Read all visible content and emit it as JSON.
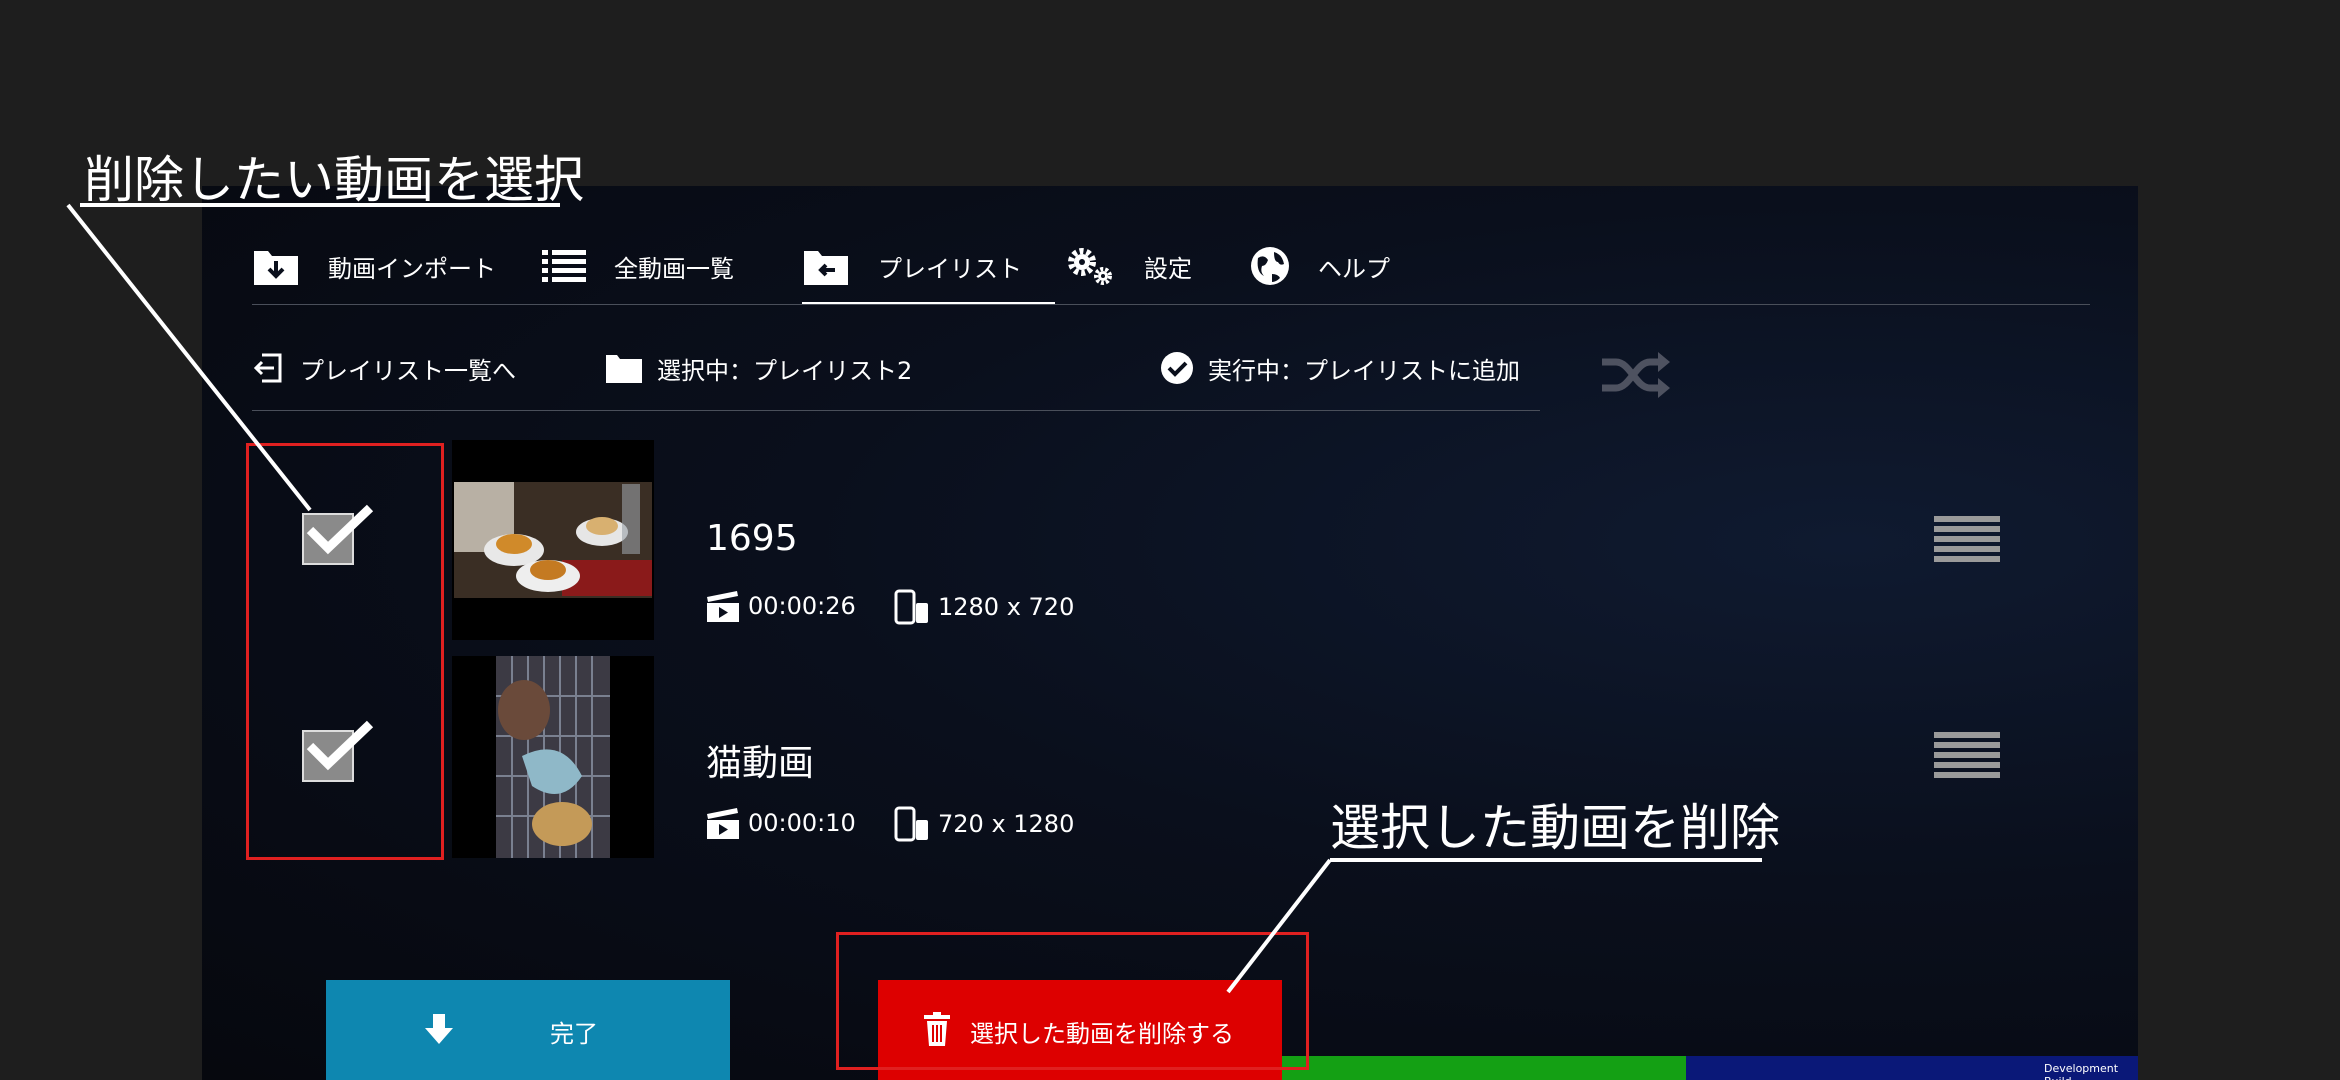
{
  "tabs": [
    {
      "label": "動画インポート",
      "icon": "import-folder-icon"
    },
    {
      "label": "全動画一覧",
      "icon": "list-icon"
    },
    {
      "label": "プレイリスト",
      "icon": "playlist-folder-icon",
      "active": true
    },
    {
      "label": "設定",
      "icon": "gears-icon"
    },
    {
      "label": "ヘルプ",
      "icon": "globe-icon"
    }
  ],
  "subbar": {
    "back_label": "プレイリスト一覧へ",
    "selected_label": "選択中：プレイリスト2",
    "running_label": "実行中：プレイリストに追加"
  },
  "videos": [
    {
      "title": "1695",
      "duration": "00:00:26",
      "resolution": "1280 x 720",
      "checked": true
    },
    {
      "title": "猫動画",
      "duration": "00:00:10",
      "resolution": "720 x 1280",
      "checked": true
    }
  ],
  "buttons": {
    "done_label": "完了",
    "delete_label": "選択した動画を削除する"
  },
  "annotations": {
    "select_label": "削除したい動画を選択",
    "delete_label": "選択した動画を削除"
  },
  "footer": {
    "build_label": "Development Build"
  },
  "colors": {
    "done": "#0e87b0",
    "delete": "#dd0000",
    "green": "#14a014",
    "navy": "#0a1878",
    "annotation": "#e02020"
  }
}
